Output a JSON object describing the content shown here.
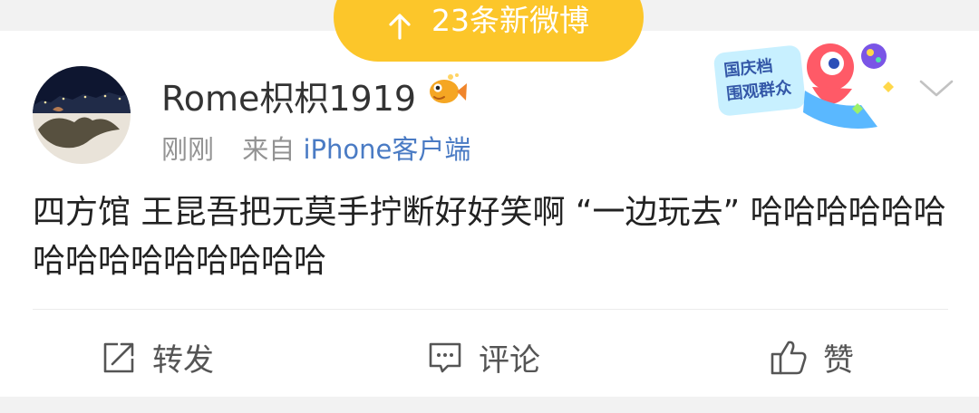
{
  "banner": {
    "new_posts_text": "23条新微博"
  },
  "post": {
    "username": "Rome枳枳1919",
    "time": "刚刚",
    "source_prefix": "来自",
    "source_device": "iPhone客户端",
    "text": "四方馆 王昆吾把元莫手拧断好好笑啊 “一边玩去” 哈哈哈哈哈哈 哈哈哈哈哈哈哈哈哈",
    "sticker_text_line1": "国庆档",
    "sticker_text_line2": "围观群众"
  },
  "actions": {
    "repost_label": "转发",
    "comment_label": "评论",
    "like_label": "赞"
  },
  "colors": {
    "accent_yellow": "#fcc62a",
    "link_blue": "#4a7bc4",
    "text_gray": "#939393",
    "text_dark": "#222222"
  }
}
